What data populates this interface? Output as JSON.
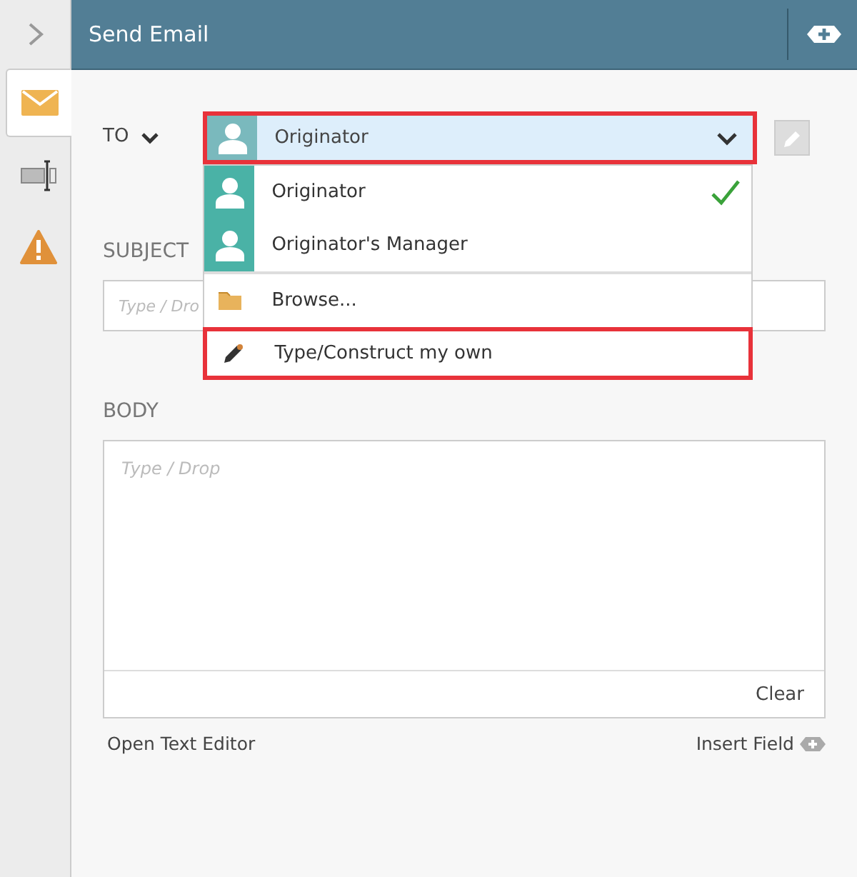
{
  "header": {
    "title": "Send Email"
  },
  "sidebar": {
    "tabs": [
      {
        "kind": "mail",
        "selected": true
      },
      {
        "kind": "text",
        "selected": false
      },
      {
        "kind": "warning",
        "selected": false
      }
    ]
  },
  "to": {
    "label": "TO",
    "value": "Originator",
    "highlighted": true,
    "expanded": true
  },
  "menu": [
    {
      "kind": "person",
      "label": "Originator",
      "selected": true,
      "highlighted": false
    },
    {
      "kind": "person",
      "label": "Originator's Manager",
      "selected": false,
      "highlighted": false
    },
    {
      "kind": "folder",
      "label": "Browse...",
      "selected": false,
      "highlighted": false
    },
    {
      "kind": "pencil",
      "label": "Type/Construct my own",
      "selected": false,
      "highlighted": true
    }
  ],
  "subject": {
    "label": "SUBJECT",
    "placeholder": "Type / Dro"
  },
  "body": {
    "label": "BODY",
    "placeholder": "Type / Drop",
    "clear": "Clear"
  },
  "footer": {
    "open_editor": "Open Text Editor",
    "insert_field": "Insert Field"
  }
}
